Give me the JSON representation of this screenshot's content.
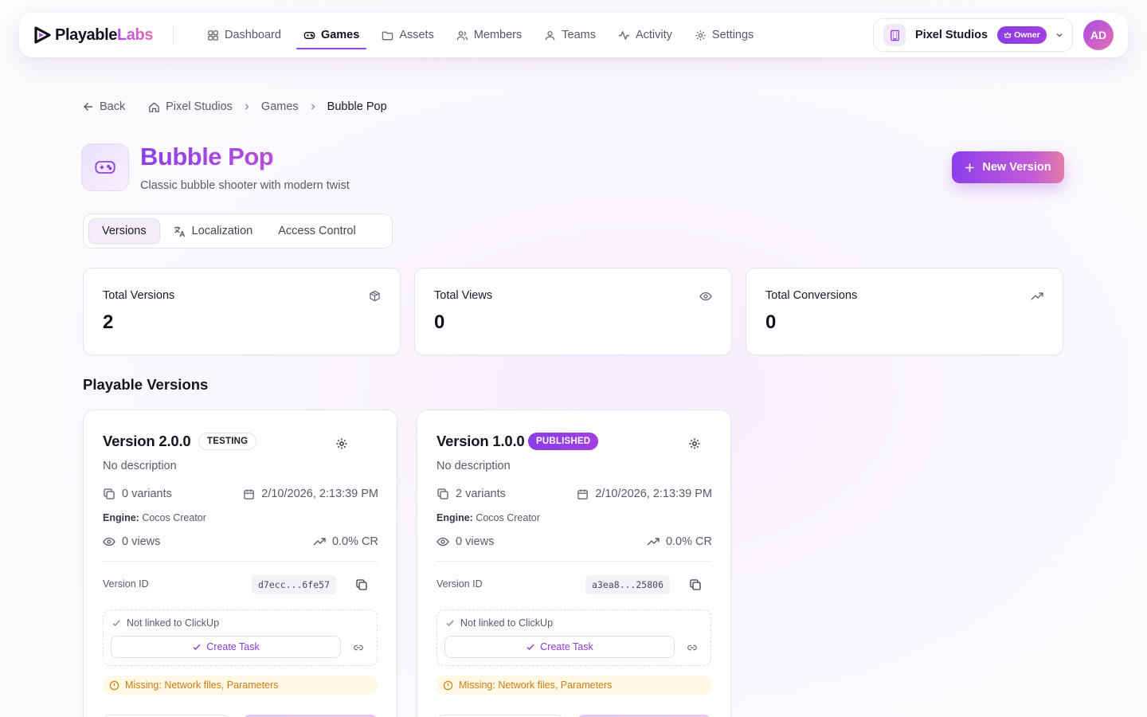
{
  "brand": {
    "name_part1": "Playable",
    "name_part2": "Labs"
  },
  "nav": {
    "items": [
      {
        "label": "Dashboard",
        "icon": "dashboard-icon",
        "active": false
      },
      {
        "label": "Games",
        "icon": "gamepad-icon",
        "active": true
      },
      {
        "label": "Assets",
        "icon": "folder-icon",
        "active": false
      },
      {
        "label": "Members",
        "icon": "users-icon",
        "active": false
      },
      {
        "label": "Teams",
        "icon": "team-icon",
        "active": false
      },
      {
        "label": "Activity",
        "icon": "activity-icon",
        "active": false
      },
      {
        "label": "Settings",
        "icon": "gear-icon",
        "active": false
      }
    ]
  },
  "org": {
    "name": "Pixel Studios",
    "role": "Owner"
  },
  "user": {
    "initials": "AD"
  },
  "breadcrumb": {
    "back": "Back",
    "items": [
      "Pixel Studios",
      "Games",
      "Bubble Pop"
    ]
  },
  "game": {
    "title": "Bubble Pop",
    "subtitle": "Classic bubble shooter with modern twist",
    "new_version_label": "New Version"
  },
  "tabs": [
    {
      "label": "Versions",
      "active": true
    },
    {
      "label": "Localization",
      "active": false,
      "icon": "translate-icon"
    },
    {
      "label": "Access Control",
      "active": false
    }
  ],
  "stats": [
    {
      "label": "Total Versions",
      "value": "2",
      "icon": "package-icon"
    },
    {
      "label": "Total Views",
      "value": "0",
      "icon": "eye-icon"
    },
    {
      "label": "Total Conversions",
      "value": "0",
      "icon": "trending-up-icon"
    }
  ],
  "section_title": "Playable Versions",
  "versions": [
    {
      "title": "Version 2.0.0",
      "status": "TESTING",
      "description": "No description",
      "variants": "0 variants",
      "date": "2/10/2026, 2:13:39 PM",
      "engine_label": "Engine:",
      "engine": "Cocos Creator",
      "views": "0 views",
      "cr": "0.0% CR",
      "version_id_label": "Version ID",
      "version_id": "d7ecc...6fe57",
      "clickup_status": "Not linked to ClickUp",
      "create_task": "Create Task",
      "missing": "Missing: Network files, Parameters"
    },
    {
      "title": "Version 1.0.0",
      "status": "PUBLISHED",
      "description": "No description",
      "variants": "2 variants",
      "date": "2/10/2026, 2:13:39 PM",
      "engine_label": "Engine:",
      "engine": "Cocos Creator",
      "views": "0 views",
      "cr": "0.0% CR",
      "version_id_label": "Version ID",
      "version_id": "a3ea8...25806",
      "clickup_status": "Not linked to ClickUp",
      "create_task": "Create Task",
      "missing": "Missing: Network files, Parameters"
    }
  ],
  "colors": {
    "accent": "#9b3fe6",
    "accent_pink": "#e36bb0",
    "warning": "#d27a12"
  }
}
